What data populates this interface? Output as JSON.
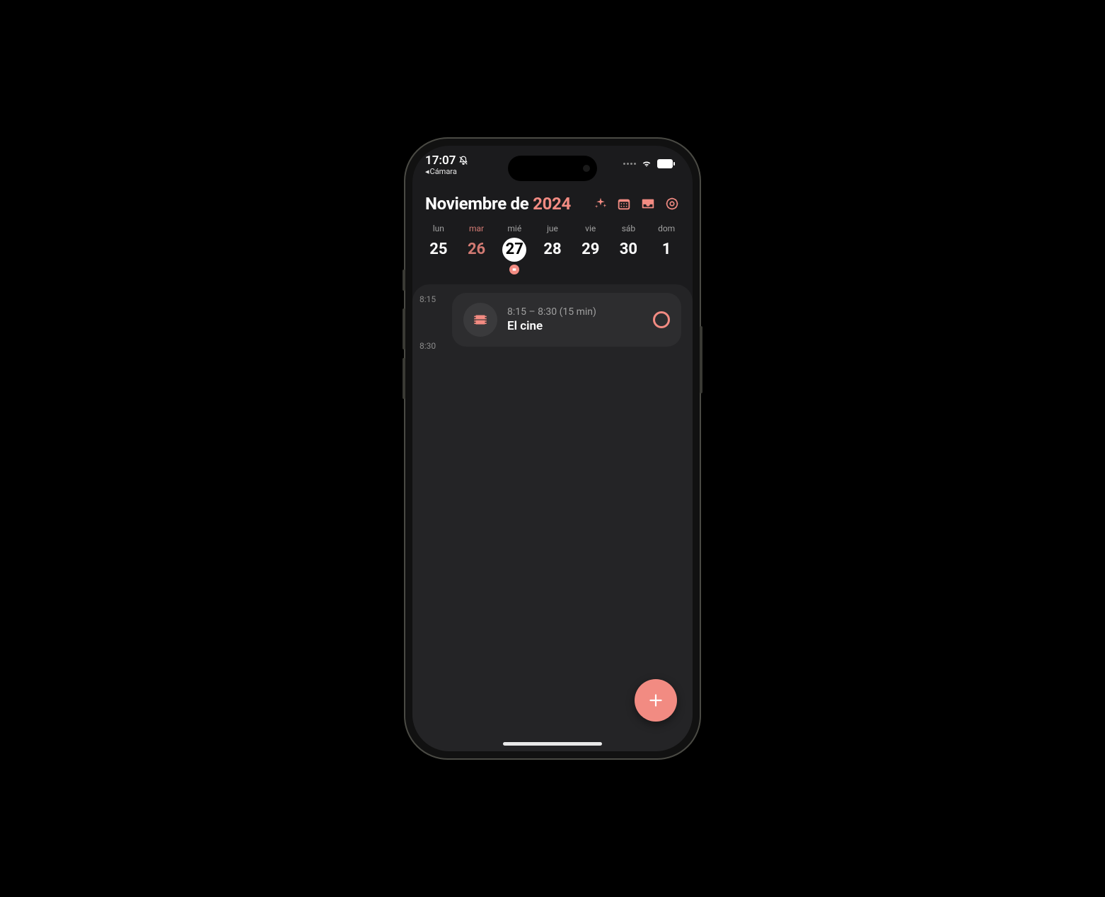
{
  "statusbar": {
    "time": "17:07",
    "back_label": "Cámara"
  },
  "header": {
    "month": "Noviembre de",
    "year": "2024"
  },
  "week": {
    "days": [
      {
        "label": "lun",
        "num": "25"
      },
      {
        "label": "mar",
        "num": "26"
      },
      {
        "label": "mié",
        "num": "27"
      },
      {
        "label": "jue",
        "num": "28"
      },
      {
        "label": "vie",
        "num": "29"
      },
      {
        "label": "sáb",
        "num": "30"
      },
      {
        "label": "dom",
        "num": "1"
      }
    ]
  },
  "timeline": {
    "label1": "8:15",
    "label2": "8:30"
  },
  "event": {
    "time": "8:15 – 8:30 (15 min)",
    "title": "El cine"
  },
  "colors": {
    "accent": "#f28b82"
  }
}
